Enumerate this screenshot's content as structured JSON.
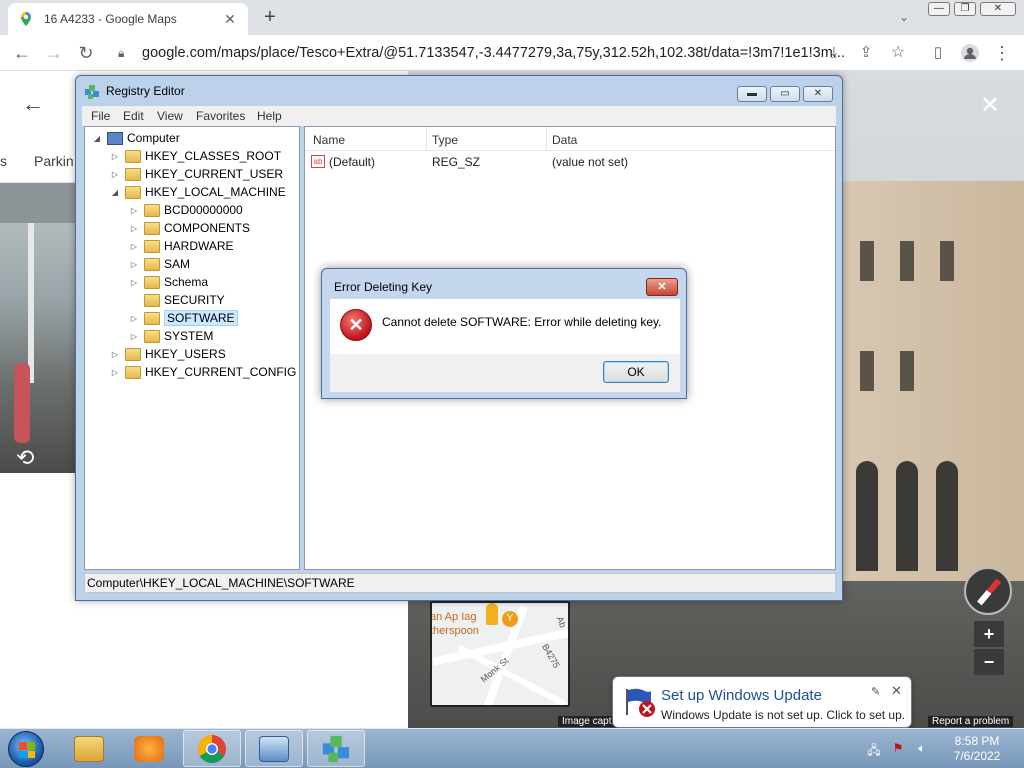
{
  "browser": {
    "tab_title": "16 A4233 - Google Maps",
    "url": "google.com/maps/place/Tesco+Extra/@51.7133547,-3.4477279,3a,75y,312.52h,102.38t/data=!3m7!1e1!3m..."
  },
  "maps": {
    "panel_tab_prev": "s",
    "panel_tab_label": "Parkin",
    "minimap": {
      "place_label_1": "an Ap Iag",
      "place_label_2": "therspoon",
      "street_1": "Monk St",
      "street_2": "B4275",
      "street_3": "Ab"
    },
    "image_capture": "Image capt",
    "report_problem": "Report a problem"
  },
  "regedit": {
    "title": "Registry Editor",
    "menu": [
      "File",
      "Edit",
      "View",
      "Favorites",
      "Help"
    ],
    "tree": {
      "computer": "Computer",
      "hkcr": "HKEY_CLASSES_ROOT",
      "hkcu": "HKEY_CURRENT_USER",
      "hklm": "HKEY_LOCAL_MACHINE",
      "hklm_children": [
        "BCD00000000",
        "COMPONENTS",
        "HARDWARE",
        "SAM",
        "Schema",
        "SECURITY",
        "SOFTWARE",
        "SYSTEM"
      ],
      "hku": "HKEY_USERS",
      "hkcc": "HKEY_CURRENT_CONFIG",
      "selected": "SOFTWARE"
    },
    "columns": [
      "Name",
      "Type",
      "Data"
    ],
    "values": [
      {
        "name": "(Default)",
        "type": "REG_SZ",
        "data": "(value not set)"
      }
    ],
    "status_path": "Computer\\HKEY_LOCAL_MACHINE\\SOFTWARE"
  },
  "error_dialog": {
    "title": "Error Deleting Key",
    "message": "Cannot delete SOFTWARE:  Error while deleting key.",
    "ok_label": "OK"
  },
  "update_balloon": {
    "title": "Set up Windows Update",
    "text": "Windows Update is not set up. Click to set up."
  },
  "taskbar": {
    "time": "8:58 PM",
    "date": "7/6/2022"
  },
  "colors": {
    "error_red": "#c1121b",
    "balloon_title": "#1f4e9c",
    "taskbar": "#7897b8"
  }
}
